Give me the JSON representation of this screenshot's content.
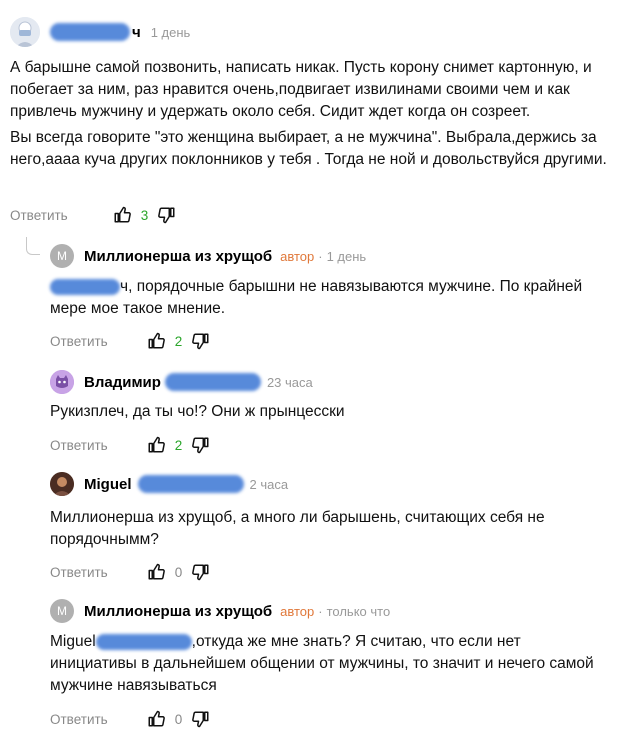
{
  "reply_label": "Ответить",
  "author_tag": "автор",
  "sep": "·",
  "comments": [
    {
      "name_visible": "ч",
      "time": "1 день",
      "paragraphs": [
        "А барышне самой позвонить, написать никак. Пусть корону снимет картонную, и побегает за ним, раз нравится очень,подвигает извилинами своими чем и как привлечь мужчину и удержать около себя. Сидит ждет когда он созреет.",
        "Вы всегда говорите \"это женщина выбирает, а не мужчина\". Выбрала,держись за него,аааа куча других поклонников у тебя . Тогда не ной и довольствуйся другими."
      ],
      "likes": "3"
    },
    {
      "avatar_letter": "М",
      "name": "Миллионерша из хрущоб",
      "time": "1 день",
      "text_after_blur": "ч, порядочные барышни не навязываются мужчине. По крайней мере мое такое мнение.",
      "likes": "2"
    },
    {
      "name": "Владимир",
      "time": "23 часа",
      "text": "Рукизплеч, да ты чо!? Они ж прынцесски",
      "likes": "2"
    },
    {
      "name": "Miguel",
      "time": "2 часа",
      "text": "Миллионерша из хрущоб, а много ли барышень, считающих себя не порядочнымм?",
      "likes": "0"
    },
    {
      "avatar_letter": "М",
      "name": "Миллионерша из хрущоб",
      "time": "только что",
      "text_prefix": "Miguel",
      "text_after_blur": ",откуда же мне знать? Я считаю, что если нет инициативы в дальнейшем общении от мужчины, то значит и нечего самой мужчине навязываться",
      "likes": "0"
    }
  ],
  "colors": {
    "author": "#e0783a",
    "positive": "#2aa52a",
    "muted": "#888888",
    "redaction": "#4f84d9"
  },
  "icons": [
    "thumb-up-icon",
    "thumb-down-icon",
    "mask-avatar-icon",
    "cat-avatar-icon"
  ]
}
